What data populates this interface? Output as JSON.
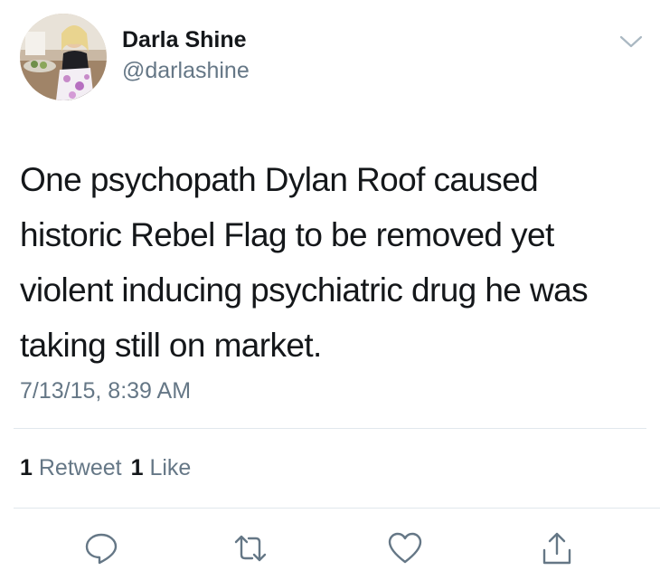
{
  "author": {
    "display_name": "Darla Shine",
    "handle": "@darlashine"
  },
  "tweet": {
    "lines": [
      "One psychopath Dylan Roof caused",
      "historic Rebel Flag to be removed yet",
      "violent inducing psychiatric drug he was",
      "taking still on market."
    ],
    "timestamp": "7/13/15, 8:39 AM"
  },
  "stats": {
    "retweet_count": "1",
    "retweet_label": "Retweet",
    "like_count": "1",
    "like_label": "Like"
  },
  "icons": {
    "menu": "chevron-down-icon",
    "reply": "reply-icon",
    "retweet": "retweet-icon",
    "like": "heart-icon",
    "share": "share-icon"
  },
  "colors": {
    "text": "#14171a",
    "secondary": "#657786",
    "divider": "#e1e8ed"
  }
}
